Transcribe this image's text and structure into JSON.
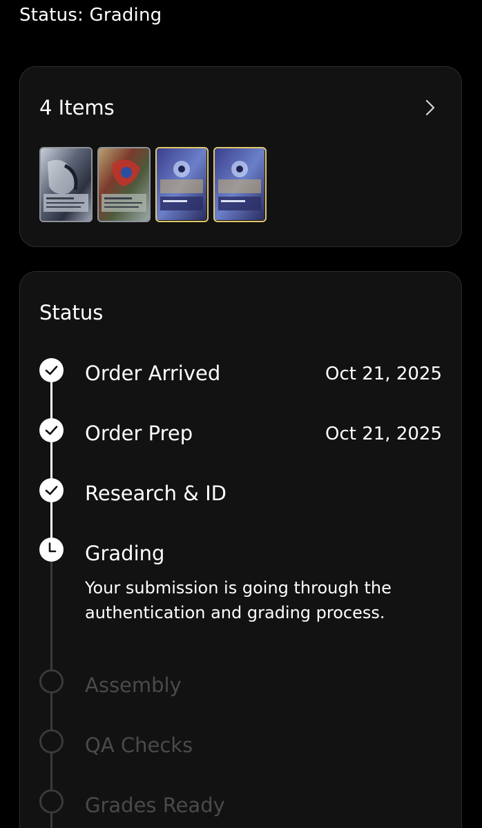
{
  "header": {
    "status_line": "Status: Grading"
  },
  "items_card": {
    "title": "4 Items",
    "chevron_icon": "chevron-right-icon",
    "cards": [
      {
        "name": "trading-card-1",
        "border": "#8f949c"
      },
      {
        "name": "trading-card-2",
        "border": "#8f949c"
      },
      {
        "name": "trading-card-3",
        "border": "#e2c96a"
      },
      {
        "name": "trading-card-4",
        "border": "#e2c96a"
      }
    ]
  },
  "status_card": {
    "heading": "Status",
    "steps": [
      {
        "label": "Order Arrived",
        "date": "Oct 21, 2025",
        "state": "done",
        "icon": "check-icon"
      },
      {
        "label": "Order Prep",
        "date": "Oct 21, 2025",
        "state": "done",
        "icon": "check-icon"
      },
      {
        "label": "Research & ID",
        "date": "",
        "state": "done",
        "icon": "check-icon"
      },
      {
        "label": "Grading",
        "date": "",
        "state": "current",
        "icon": "clock-icon",
        "description": "Your submission is going through the authentication and grading process."
      },
      {
        "label": "Assembly",
        "date": "",
        "state": "pending",
        "icon": "empty-circle-icon"
      },
      {
        "label": "QA Checks",
        "date": "",
        "state": "pending",
        "icon": "empty-circle-icon"
      },
      {
        "label": "Grades Ready",
        "date": "",
        "state": "pending",
        "icon": "empty-circle-icon"
      }
    ]
  },
  "colors": {
    "background": "#000000",
    "card": "#121212",
    "card_border": "#2e2e2e",
    "pending_text": "#4a4a4a",
    "done": "#ffffff"
  }
}
